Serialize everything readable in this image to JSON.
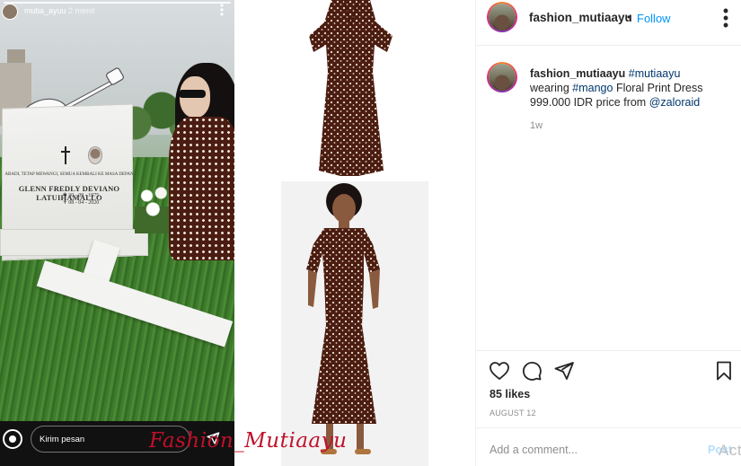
{
  "story": {
    "username": "mutia_ayuu",
    "time": "2 menit",
    "reply_placeholder": "Kirim pesan",
    "tombstone": {
      "line_top": "ABADI, TETAP MEWANGI, SEMUA KEMBALI KE MASA DEPAN",
      "name": "GLENN FREDLY DEVIANO LATUIHAMALLO",
      "born": "✱ 30 - 09 - 1975",
      "died": "✝ 08 - 04 - 2020"
    }
  },
  "watermark": "Fashion_Mutiaayu",
  "post": {
    "username": "fashion_mutiaayu",
    "separator": "•",
    "follow_label": "Follow",
    "caption": {
      "username": "fashion_mutiaayu",
      "hashtag_profile": "#mutiaayu",
      "word_wearing": "wearing",
      "hashtag_brand": "#mango",
      "product": "Floral Print Dress",
      "price": "999.000 IDR price from",
      "mention": "@zaloraid"
    },
    "time_ago": "1w",
    "likes": "85 likes",
    "date": "AUGUST 12",
    "comment_placeholder": "Add a comment...",
    "post_button": "Post",
    "activate_overlay": "Act"
  },
  "icons": {
    "like": "heart-icon",
    "comment": "comment-icon",
    "share": "share-icon",
    "save": "bookmark-icon",
    "more": "more-options-icon",
    "send": "send-icon",
    "camera": "camera-icon"
  },
  "colors": {
    "follow_blue": "#0095f6",
    "tag_blue": "#00376b",
    "watermark_red": "#c0102a",
    "post_disabled": "#b2dffc",
    "dress_brown": "#4b1d12"
  }
}
